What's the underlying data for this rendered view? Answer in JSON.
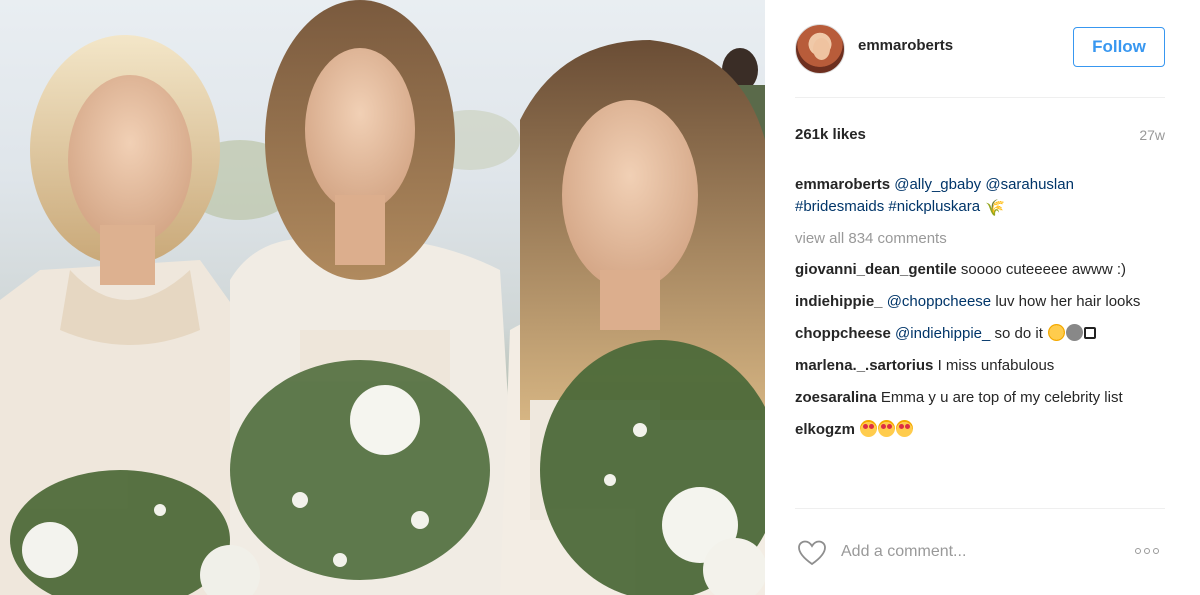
{
  "post": {
    "username": "emmaroberts",
    "follow_label": "Follow",
    "likes": "261k likes",
    "time": "27w"
  },
  "caption": {
    "user": "emmaroberts",
    "mention_1": "@ally_gbaby",
    "mention_2": "@sarahuslan",
    "tag_1": "#bridesmaids",
    "tag_2": "#nickpluskara"
  },
  "view_all_label": "view all 834 comments",
  "comments": [
    {
      "user": "giovanni_dean_gentile",
      "text": "soooo cuteeeee awww :)"
    },
    {
      "user": "indiehippie_",
      "mention": "@choppcheese",
      "text": "luv how her hair looks"
    },
    {
      "user": "choppcheese",
      "mention": "@indiehippie_",
      "text": "so do it"
    },
    {
      "user": "marlena._.sartorius",
      "text": "I miss unfabulous"
    },
    {
      "user": "zoesaralina",
      "text": "Emma y u are top of my celebrity list"
    },
    {
      "user": "elkogzm",
      "text": ""
    }
  ],
  "footer": {
    "add_comment_placeholder": "Add a comment..."
  },
  "icons": {
    "like": "heart-outline-icon",
    "more": "more-options-icon",
    "emoji_caption": "sheaf-of-rice-emoji",
    "emoji_hearts": "heart-eyes-emoji",
    "emoji_choppcheese": "flushed-face-emoji"
  },
  "colors": {
    "accent": "#3897f0",
    "link": "#003569",
    "muted": "#999999",
    "text": "#262626"
  }
}
